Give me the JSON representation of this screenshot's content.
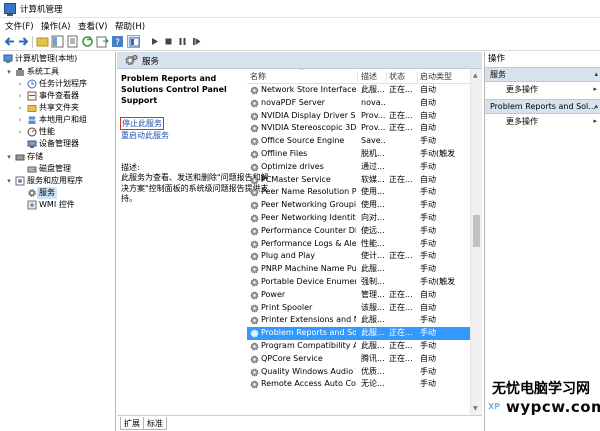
{
  "window": {
    "title": "计算机管理"
  },
  "menu": [
    "文件(F)",
    "操作(A)",
    "查看(V)",
    "帮助(H)"
  ],
  "toolbar": {
    "buttons": [
      "back",
      "forward",
      "up",
      "show-hide-tree",
      "properties",
      "refresh",
      "export",
      "help",
      "console",
      "start",
      "stop",
      "pause",
      "restart"
    ]
  },
  "tree": [
    {
      "label": "计算机管理(本地)",
      "icon": "computer-icon",
      "level": 0,
      "expanded": true
    },
    {
      "label": "系统工具",
      "icon": "tools-icon",
      "level": 1,
      "expanded": true
    },
    {
      "label": "任务计划程序",
      "icon": "clock-icon",
      "level": 2,
      "expanded": false
    },
    {
      "label": "事件查看器",
      "icon": "event-icon",
      "level": 2,
      "expanded": false
    },
    {
      "label": "共享文件夹",
      "icon": "folder-icon",
      "level": 2,
      "expanded": false
    },
    {
      "label": "本地用户和组",
      "icon": "users-icon",
      "level": 2,
      "expanded": false
    },
    {
      "label": "性能",
      "icon": "performance-icon",
      "level": 2,
      "expanded": false
    },
    {
      "label": "设备管理器",
      "icon": "device-icon",
      "level": 2,
      "expanded": null
    },
    {
      "label": "存储",
      "icon": "storage-icon",
      "level": 1,
      "expanded": true
    },
    {
      "label": "磁盘管理",
      "icon": "disk-icon",
      "level": 2,
      "expanded": null
    },
    {
      "label": "服务和应用程序",
      "icon": "apps-icon",
      "level": 1,
      "expanded": true
    },
    {
      "label": "服务",
      "icon": "gear-icon",
      "level": 2,
      "expanded": null,
      "selected": true
    },
    {
      "label": "WMI 控件",
      "icon": "wmi-icon",
      "level": 2,
      "expanded": null
    }
  ],
  "center": {
    "header_title": "服务",
    "detail": {
      "title": "Problem Reports and Solutions Control Panel Support",
      "stop_link": "停止此服务",
      "restart_link": "重启动此服务",
      "description_label": "描述:",
      "description": "此服务为查看、发送和删除\"问题报告和解决方案\"控制面板的系统级问题报告提供支持。"
    },
    "columns": [
      "名称",
      "描述",
      "状态",
      "启动类型"
    ],
    "services": [
      {
        "name": "Network Store Interface ...",
        "desc": "此服...",
        "status": "正在...",
        "startup": "自动"
      },
      {
        "name": "novaPDF Server",
        "desc": "nova...",
        "status": "",
        "startup": "自动"
      },
      {
        "name": "NVIDIA Display Driver Se...",
        "desc": "Prov...",
        "status": "正在...",
        "startup": "自动"
      },
      {
        "name": "NVIDIA Stereoscopic 3D ...",
        "desc": "Prov...",
        "status": "正在...",
        "startup": "自动"
      },
      {
        "name": "Office  Source Engine",
        "desc": "Save...",
        "status": "",
        "startup": "手动"
      },
      {
        "name": "Offline Files",
        "desc": "脱机...",
        "status": "",
        "startup": "手动(触发..."
      },
      {
        "name": "Optimize drives",
        "desc": "通过...",
        "status": "",
        "startup": "手动"
      },
      {
        "name": "PCMaster Service",
        "desc": "软媒...",
        "status": "正在...",
        "startup": "自动"
      },
      {
        "name": "Peer Name Resolution Pr...",
        "desc": "使用...",
        "status": "",
        "startup": "手动"
      },
      {
        "name": "Peer Networking Groupi...",
        "desc": "使用...",
        "status": "",
        "startup": "手动"
      },
      {
        "name": "Peer Networking Identity...",
        "desc": "向对...",
        "status": "",
        "startup": "手动"
      },
      {
        "name": "Performance Counter DL...",
        "desc": "使远...",
        "status": "",
        "startup": "手动"
      },
      {
        "name": "Performance Logs & Aler...",
        "desc": "性能...",
        "status": "",
        "startup": "手动"
      },
      {
        "name": "Plug and Play",
        "desc": "使计...",
        "status": "正在...",
        "startup": "手动"
      },
      {
        "name": "PNRP Machine Name Pu...",
        "desc": "此服...",
        "status": "",
        "startup": "手动"
      },
      {
        "name": "Portable Device Enumera...",
        "desc": "强制...",
        "status": "",
        "startup": "手动(触发..."
      },
      {
        "name": "Power",
        "desc": "管理...",
        "status": "正在...",
        "startup": "自动"
      },
      {
        "name": "Print Spooler",
        "desc": "该服...",
        "status": "正在...",
        "startup": "自动"
      },
      {
        "name": "Printer Extensions and N...",
        "desc": "此服...",
        "status": "",
        "startup": "手动"
      },
      {
        "name": "Problem Reports and Sol...",
        "desc": "此服...",
        "status": "正在...",
        "startup": "手动",
        "selected": true
      },
      {
        "name": "Program Compatibility A...",
        "desc": "此服...",
        "status": "正在...",
        "startup": "手动"
      },
      {
        "name": "QPCore Service",
        "desc": "腾讯...",
        "status": "正在...",
        "startup": "自动"
      },
      {
        "name": "Quality Windows Audio V...",
        "desc": "优质...",
        "status": "",
        "startup": "手动"
      },
      {
        "name": "Remote Access Auto Con...",
        "desc": "无论...",
        "status": "",
        "startup": "手动"
      }
    ],
    "tabs": [
      "扩展",
      "标准"
    ]
  },
  "actions": {
    "header": "操作",
    "sections": [
      {
        "title": "服务",
        "items": [
          "更多操作"
        ]
      },
      {
        "title": "Problem Reports and Sol...",
        "items": [
          "更多操作"
        ]
      }
    ]
  },
  "watermark": {
    "line1": "无忧电脑学习网",
    "line2": "wypcw.com",
    "prefix": "XP"
  },
  "colors": {
    "selection": "#3399ff",
    "header_bg": "#d7e2ef",
    "link": "#1e50b0",
    "highlight_box": "#c0392b"
  }
}
